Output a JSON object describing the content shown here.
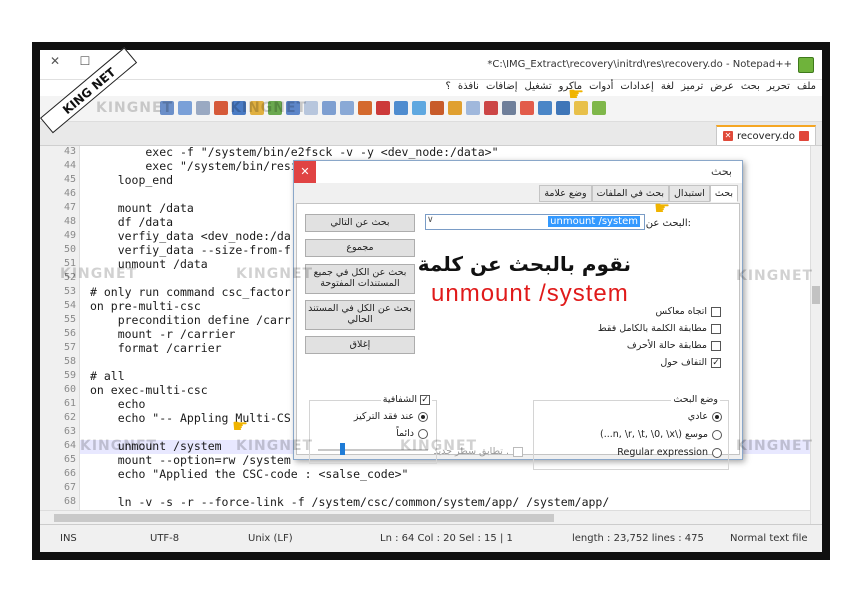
{
  "watermark": {
    "corner": "KING NET",
    "text": "KINGNET"
  },
  "window": {
    "title": "*C:\\IMG_Extract\\recovery\\initrd\\res\\recovery.do - Notepad++"
  },
  "menu": [
    "ملف",
    "تحرير",
    "بحث",
    "عرض",
    "ترميز",
    "لغة",
    "إعدادات",
    "أدوات",
    "ماكرو",
    "تشغيل",
    "إضافات",
    "نافذة",
    "؟"
  ],
  "tab": {
    "label": "recovery.do"
  },
  "editor": {
    "lines": [
      {
        "n": "43",
        "text": "        exec -f \"/system/bin/e2fsck -v -y <dev_node:/data>\""
      },
      {
        "n": "44",
        "text": "        exec \"/system/bin/resize2fs\""
      },
      {
        "n": "45",
        "text": "    loop_end"
      },
      {
        "n": "46",
        "text": ""
      },
      {
        "n": "47",
        "text": "    mount /data"
      },
      {
        "n": "48",
        "text": "    df /data"
      },
      {
        "n": "49",
        "text": "    verfiy_data <dev_node:/da"
      },
      {
        "n": "50",
        "text": "    verfiy_data --size-from-f"
      },
      {
        "n": "51",
        "text": "    unmount /data"
      },
      {
        "n": "52",
        "text": ""
      },
      {
        "n": "53",
        "text": "# only run command csc_factor"
      },
      {
        "n": "54",
        "text": "on pre-multi-csc"
      },
      {
        "n": "55",
        "text": "    precondition define /carr"
      },
      {
        "n": "56",
        "text": "    mount -r /carrier"
      },
      {
        "n": "57",
        "text": "    format /carrier"
      },
      {
        "n": "58",
        "text": ""
      },
      {
        "n": "59",
        "text": "# all"
      },
      {
        "n": "60",
        "text": "on exec-multi-csc"
      },
      {
        "n": "61",
        "text": "    echo"
      },
      {
        "n": "62",
        "text": "    echo \"-- Appling Multi-CS"
      },
      {
        "n": "63",
        "text": ""
      },
      {
        "n": "64",
        "text": "    unmount /system"
      },
      {
        "n": "65",
        "text": "    mount --option=rw /system"
      },
      {
        "n": "66",
        "text": "    echo \"Applied the CSC-code : <salse_code>\""
      },
      {
        "n": "67",
        "text": ""
      },
      {
        "n": "68",
        "text": "    ln -v -s -r --force-link -f /system/csc/common/system/app/ /system/app/"
      }
    ]
  },
  "status": {
    "mode": "INS",
    "encoding": "UTF-8",
    "eol": "Unix (LF)",
    "position": "Ln : 64   Col : 20   Sel : 15 | 1",
    "length": "length : 23,752   lines : 475",
    "filetype": "Normal text file"
  },
  "dialog": {
    "title": "بحث",
    "tabs": [
      "بحث",
      "استبدال",
      "بحث في الملفات",
      "وضع علامة"
    ],
    "find_label": "البحث عن:",
    "find_value": "unmount /system",
    "buttons": {
      "find_next": "بحث عن التالي",
      "count": "مجموع",
      "find_all_open": "بحث عن الكل في جميع المستندات المفتوحة",
      "find_all_current": "بحث عن الكل في المستند الحالي",
      "close": "إغلاق"
    },
    "overlay_ar": "نقوم بالبحث عن كلمة",
    "overlay_en": "unmount /system",
    "options": {
      "reverse": "اتجاه معاكس",
      "whole_word": "مطابقة الكلمة بالكامل فقط",
      "match_case": "مطابقة حالة الأحرف",
      "wrap": "التفاف حول"
    },
    "search_mode": {
      "title": "وضع البحث",
      "normal": "عادي",
      "extended": "موسع (\\n, \\r, \\t, \\0, \\x...)",
      "regex": "Regular expression",
      "dot_newline": ". تطابق سطر جديد"
    },
    "transparency": {
      "title": "الشفافية",
      "on_lose_focus": "عند فقد التركيز",
      "always": "دائماً"
    }
  }
}
